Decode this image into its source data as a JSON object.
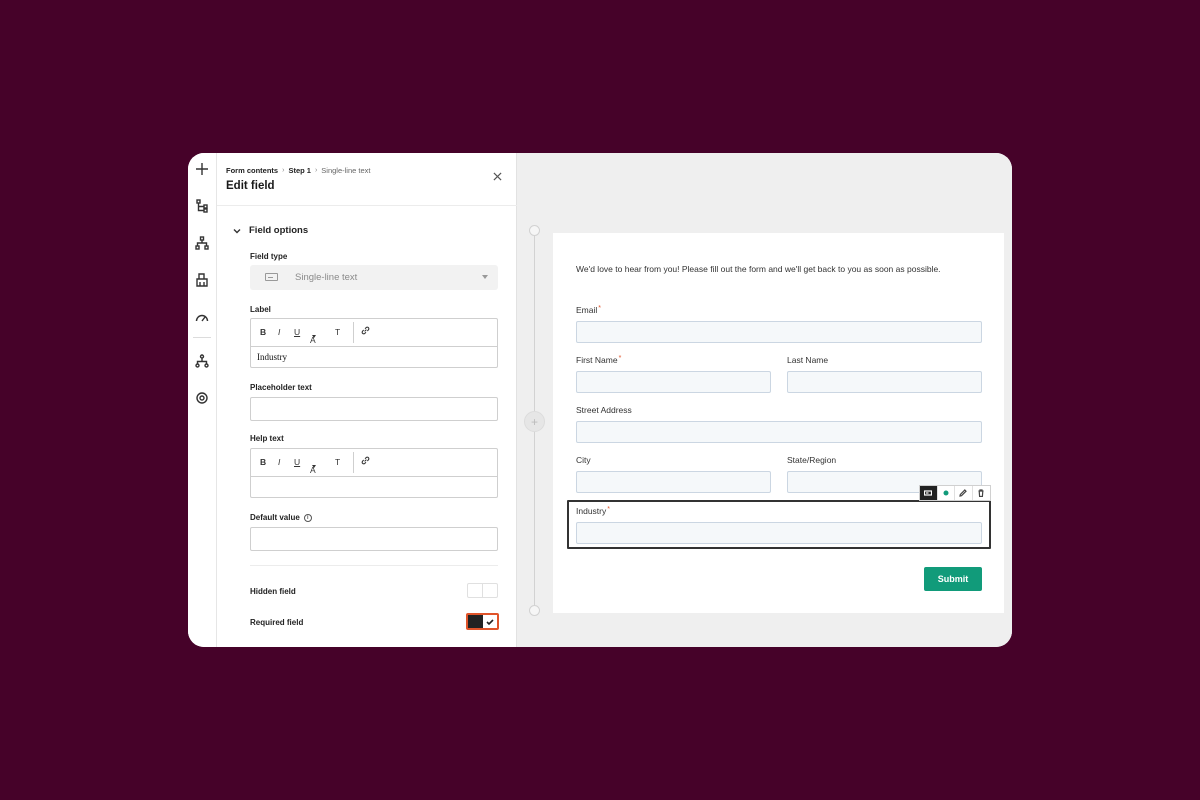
{
  "panel": {
    "breadcrumb": {
      "root": "Form contents",
      "step": "Step 1",
      "current": "Single-line text",
      "separator": "›"
    },
    "title": "Edit field",
    "section_title": "Field options",
    "field_type": {
      "label": "Field type",
      "value": "Single-line text"
    },
    "label_field": {
      "label": "Label",
      "value": "Industry"
    },
    "placeholder_field": {
      "label": "Placeholder text",
      "value": ""
    },
    "help_field": {
      "label": "Help text",
      "value": ""
    },
    "default_field": {
      "label": "Default value",
      "info": "i",
      "value": ""
    },
    "hidden_field": {
      "label": "Hidden field",
      "on": false
    },
    "required_field": {
      "label": "Required field",
      "on": true
    },
    "toolbar": {
      "bold": "B",
      "italic": "I",
      "underline": "U",
      "text_style": "A",
      "clear": "T"
    }
  },
  "preview": {
    "plus": "+",
    "intro": "We'd love to hear from you! Please fill out the form and we'll get back to you as soon as possible.",
    "required_mark": "*",
    "fields": {
      "email": "Email",
      "first_name": "First Name",
      "last_name": "Last Name",
      "street": "Street Address",
      "city": "City",
      "state": "State/Region",
      "industry": "Industry"
    },
    "submit": "Submit"
  },
  "colors": {
    "background": "#460229",
    "submit": "#119b7a",
    "required": "#e0542a",
    "focus_ring": "#e0542a"
  }
}
